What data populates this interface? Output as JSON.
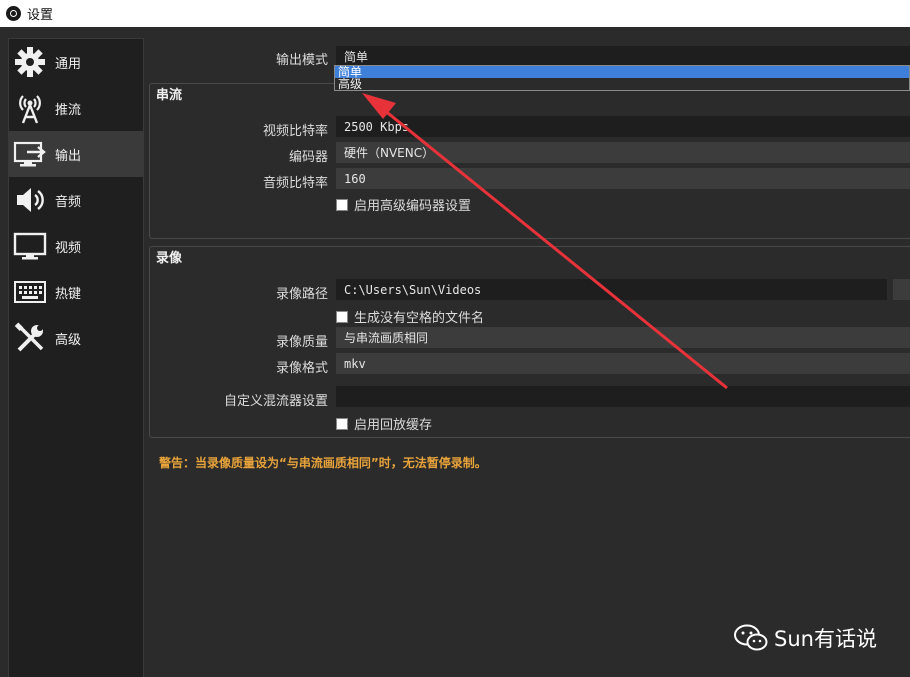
{
  "window": {
    "title": "设置"
  },
  "sidebar": {
    "items": [
      {
        "label": "通用",
        "icon": "gear-icon"
      },
      {
        "label": "推流",
        "icon": "antenna-icon"
      },
      {
        "label": "输出",
        "icon": "monitor-arrow-icon",
        "active": true
      },
      {
        "label": "音频",
        "icon": "speaker-icon"
      },
      {
        "label": "视频",
        "icon": "monitor-icon"
      },
      {
        "label": "热键",
        "icon": "keyboard-icon"
      },
      {
        "label": "高级",
        "icon": "tools-icon"
      }
    ]
  },
  "output_mode": {
    "label": "输出模式",
    "value": "简单",
    "options": [
      "简单",
      "高级"
    ]
  },
  "streaming": {
    "title": "串流",
    "video_bitrate": {
      "label": "视频比特率",
      "value": "2500 Kbps"
    },
    "encoder": {
      "label": "编码器",
      "value": "硬件（NVENC）"
    },
    "audio_bitrate": {
      "label": "音频比特率",
      "value": "160"
    },
    "advanced_encoder_checkbox": "启用高级编码器设置"
  },
  "recording": {
    "title": "录像",
    "path": {
      "label": "录像路径",
      "value": "C:\\Users\\Sun\\Videos"
    },
    "no_space_checkbox": "生成没有空格的文件名",
    "quality": {
      "label": "录像质量",
      "value": "与串流画质相同"
    },
    "format": {
      "label": "录像格式",
      "value": "mkv"
    },
    "muxer": {
      "label": "自定义混流器设置",
      "value": ""
    },
    "replay_buffer_checkbox": "启用回放缓存"
  },
  "warning": "警告：当录像质量设为“与串流画质相同”时，无法暂停录制。",
  "watermark": {
    "text": "Sun有话说",
    "icon": "wechat-icon"
  },
  "colors": {
    "highlight": "#3d7fd9",
    "warning": "#e8a33a",
    "arrow": "#e8323a"
  }
}
